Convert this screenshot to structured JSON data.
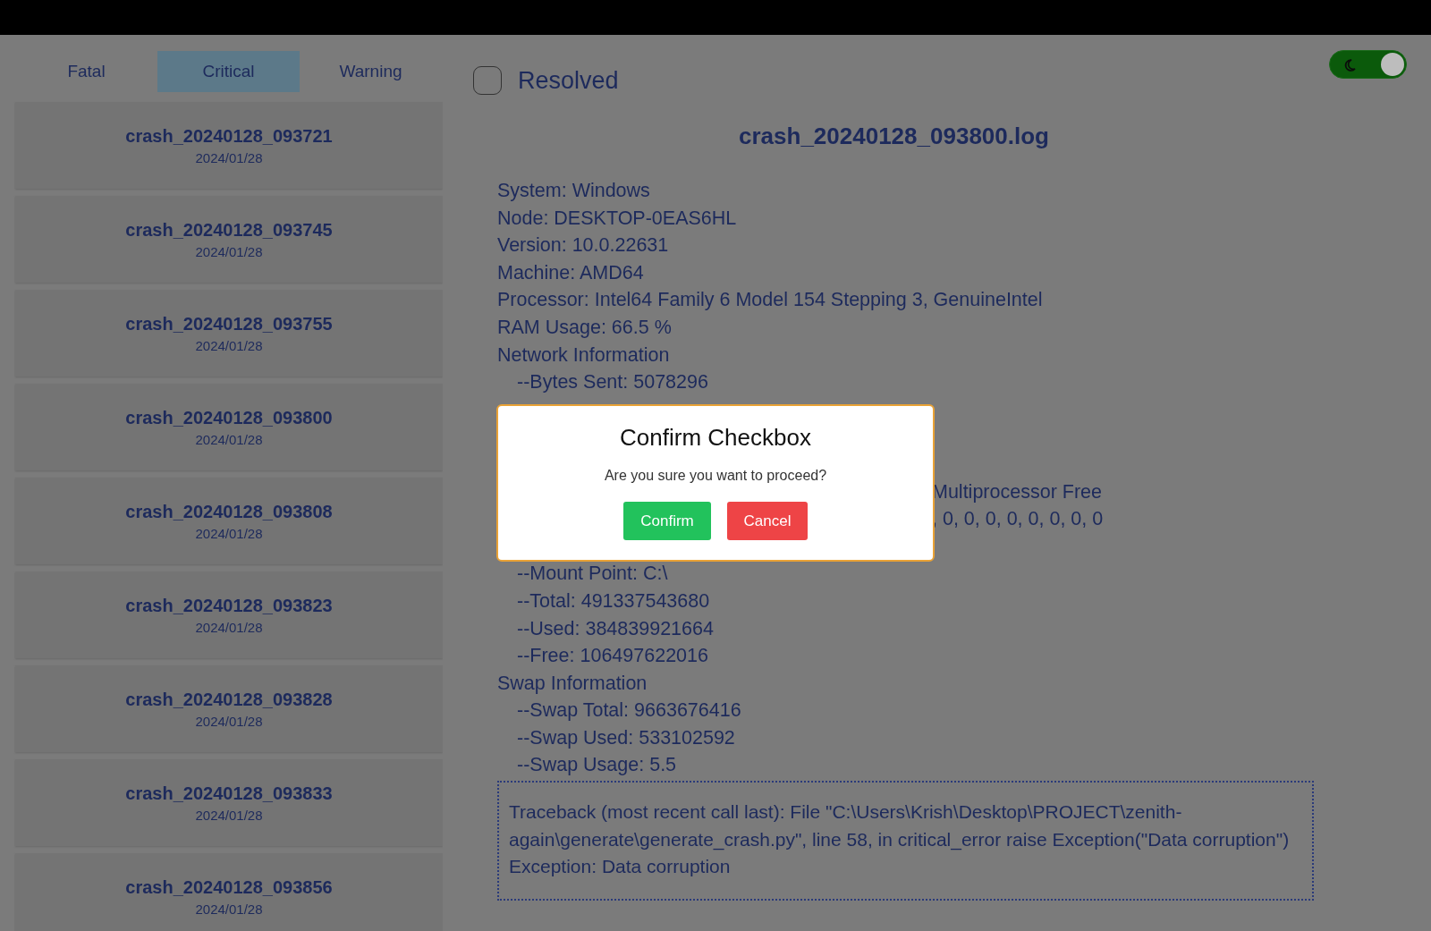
{
  "tabs": [
    {
      "label": "Fatal",
      "selected": false
    },
    {
      "label": "Critical",
      "selected": true
    },
    {
      "label": "Warning",
      "selected": false
    }
  ],
  "crashes": [
    {
      "name": "crash_20240128_093721",
      "date": "2024/01/28"
    },
    {
      "name": "crash_20240128_093745",
      "date": "2024/01/28"
    },
    {
      "name": "crash_20240128_093755",
      "date": "2024/01/28"
    },
    {
      "name": "crash_20240128_093800",
      "date": "2024/01/28"
    },
    {
      "name": "crash_20240128_093808",
      "date": "2024/01/28"
    },
    {
      "name": "crash_20240128_093823",
      "date": "2024/01/28"
    },
    {
      "name": "crash_20240128_093828",
      "date": "2024/01/28"
    },
    {
      "name": "crash_20240128_093833",
      "date": "2024/01/28"
    },
    {
      "name": "crash_20240128_093856",
      "date": "2024/01/28"
    }
  ],
  "resolved": {
    "label": "Resolved",
    "checked": false
  },
  "dark_mode": {
    "on": true
  },
  "log": {
    "title": "crash_20240128_093800.log",
    "lines": [
      {
        "text": "System: Windows",
        "indent": false
      },
      {
        "text": "Node: DESKTOP-0EAS6HL",
        "indent": false
      },
      {
        "text": "Version: 10.0.22631",
        "indent": false
      },
      {
        "text": "Machine: AMD64",
        "indent": false
      },
      {
        "text": "Processor: Intel64 Family 6 Model 154 Stepping 3, GenuineIntel",
        "indent": false
      },
      {
        "text": "RAM Usage: 66.5 %",
        "indent": false
      },
      {
        "text": "Network Information",
        "indent": false
      },
      {
        "text": "--Bytes Sent: 5078296",
        "indent": true
      }
    ],
    "partial_lines": [
      "Multiprocessor Free",
      ", 0, 0, 0, 0, 0, 0, 0, 0"
    ],
    "lines_after": [
      {
        "text": "--Mount Point: C:\\",
        "indent": true
      },
      {
        "text": "--Total: 491337543680",
        "indent": true
      },
      {
        "text": "--Used: 384839921664",
        "indent": true
      },
      {
        "text": "--Free: 106497622016",
        "indent": true
      },
      {
        "text": "Swap Information",
        "indent": false
      },
      {
        "text": "--Swap Total: 9663676416",
        "indent": true
      },
      {
        "text": "--Swap Used: 533102592",
        "indent": true
      },
      {
        "text": "--Swap Usage: 5.5",
        "indent": true
      }
    ],
    "traceback": "Traceback (most recent call last): File \"C:\\Users\\Krish\\Desktop\\PROJECT\\zenith-again\\generate\\generate_crash.py\", line 58, in critical_error raise Exception(\"Data corruption\") Exception: Data corruption"
  },
  "dialog": {
    "title": "Confirm Checkbox",
    "message": "Are you sure you want to proceed?",
    "confirm": "Confirm",
    "cancel": "Cancel"
  }
}
